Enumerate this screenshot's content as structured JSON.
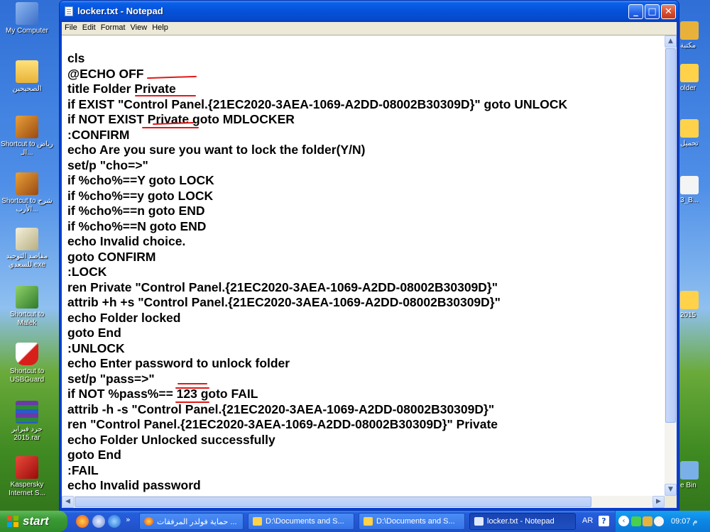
{
  "window": {
    "title": "locker.txt - Notepad",
    "buttons": {
      "minimize": "_",
      "maximize": "□",
      "close": "✕"
    }
  },
  "menu": [
    "File",
    "Edit",
    "Format",
    "View",
    "Help"
  ],
  "document_lines": [
    "cls",
    "@ECHO OFF",
    "title Folder Private",
    "if EXIST \"Control Panel.{21EC2020-3AEA-1069-A2DD-08002B30309D}\" goto UNLOCK",
    "if NOT EXIST Private goto MDLOCKER",
    ":CONFIRM",
    "echo Are you sure you want to lock the folder(Y/N)",
    "set/p \"cho=>\"",
    "if %cho%==Y goto LOCK",
    "if %cho%==y goto LOCK",
    "if %cho%==n goto END",
    "if %cho%==N goto END",
    "echo Invalid choice.",
    "goto CONFIRM",
    ":LOCK",
    "ren Private \"Control Panel.{21EC2020-3AEA-1069-A2DD-08002B30309D}\"",
    "attrib +h +s \"Control Panel.{21EC2020-3AEA-1069-A2DD-08002B30309D}\"",
    "echo Folder locked",
    "goto End",
    ":UNLOCK",
    "echo Enter password to unlock folder",
    "set/p \"pass=>\"",
    "if NOT %pass%== 123 goto FAIL",
    "attrib -h -s \"Control Panel.{21EC2020-3AEA-1069-A2DD-08002B30309D}\"",
    "ren \"Control Panel.{21EC2020-3AEA-1069-A2DD-08002B30309D}\" Private",
    "echo Folder Unlocked successfully",
    "goto End",
    ":FAIL",
    "echo Invalid password"
  ],
  "desktop_icons": [
    {
      "label": "My Computer",
      "color": "#5a8fd8"
    },
    {
      "label": "الصحيحين",
      "color": "#f0c040"
    },
    {
      "label": "Shortcut to رياض الـ...",
      "color": "#c8741a"
    },
    {
      "label": "Shortcut to شرح الأرب...",
      "color": "#c8741a"
    },
    {
      "label": "مقاصد التوحيد للسعدي.exe",
      "color": "#d9d2b0"
    },
    {
      "label": "Shortcut to Malek",
      "color": "#2f7a2a"
    },
    {
      "label": "Shortcut to USBGuard",
      "color": "#c8201a"
    },
    {
      "label": "جرد فبراير 2015.rar",
      "color": "#6a3aa8"
    },
    {
      "label": "Kaspersky Internet S...",
      "color": "#c81a1a"
    }
  ],
  "right_icons": [
    "مكتبة",
    "older",
    "تحميل",
    "3_B...",
    "2015",
    "e Bin"
  ],
  "taskbar": {
    "start_label": "start",
    "tasks": [
      {
        "label": "حماية فولدر المرفقات ...",
        "active": false
      },
      {
        "label": "D:\\Documents and S...",
        "active": false
      },
      {
        "label": "D:\\Documents and S...",
        "active": false
      },
      {
        "label": "locker.txt - Notepad",
        "active": true
      }
    ],
    "lang": "AR",
    "clock": "09:07 م"
  },
  "colors": {
    "titlebar": "#0552d8",
    "annotation": "#e01818",
    "taskbar": "#245edb",
    "start": "#3a9a34"
  }
}
